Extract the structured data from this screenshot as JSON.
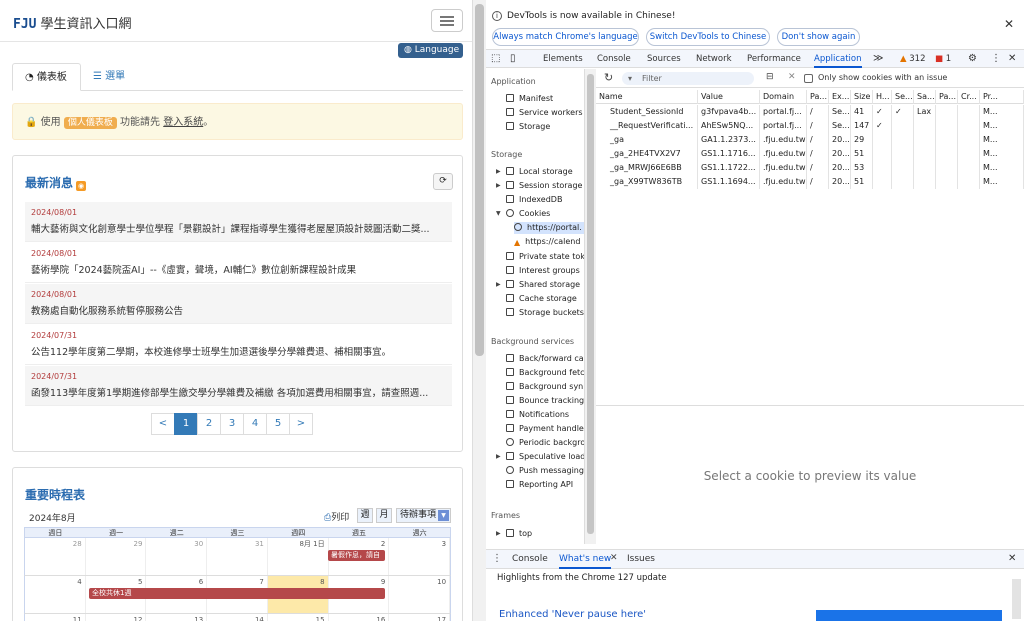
{
  "portal": {
    "brand_prefix": "FJU",
    "brand_title": "學生資訊入口網",
    "language_button": "Language",
    "tabs": [
      "儀表板",
      "選單"
    ],
    "notice": {
      "prefix": "使用",
      "badge": "個人儀表板",
      "middle": "功能請先",
      "link": "登入系統",
      "suffix": "。"
    },
    "news": {
      "title": "最新消息",
      "items": [
        {
          "date": "2024/08/01",
          "text": "輔大藝術與文化創意學士學位學程「景觀設計」課程指導學生獲得老屋屋頂設計競圖活動二獎..."
        },
        {
          "date": "2024/08/01",
          "text": "藝術學院「2024藝院盃AI」--《虛實，聲境，AI輔仁》數位創新課程設計成果"
        },
        {
          "date": "2024/08/01",
          "text": "教務處自動化服務系統暫停服務公告"
        },
        {
          "date": "2024/07/31",
          "text": "公告112學年度第二學期，本校進修學士班學生加退選後學分學雜費退、補相關事宜。"
        },
        {
          "date": "2024/07/31",
          "text": "函發113學年度第1學期進修部學生繳交學分學雜費及補繳 各項加選費用相關事宜，請查照週..."
        }
      ],
      "pager": [
        "<",
        "1",
        "2",
        "3",
        "4",
        "5",
        ">"
      ]
    },
    "schedule": {
      "title": "重要時程表",
      "month": "2024年8月",
      "print": "列印",
      "view_week": "週",
      "view_month": "月",
      "todo": "待辦事項",
      "weekdays": [
        "週日",
        "週一",
        "週二",
        "週三",
        "週四",
        "週五",
        "週六"
      ],
      "rows": [
        [
          "28",
          "29",
          "30",
          "31",
          "8月 1日",
          "2",
          "3"
        ],
        [
          "4",
          "5",
          "6",
          "7",
          "8",
          "9",
          "10"
        ],
        [
          "11",
          "12",
          "13",
          "14",
          "15",
          "16",
          "17"
        ]
      ],
      "events": [
        "暑假作息，請自",
        "全校共休1週"
      ]
    }
  },
  "devtools": {
    "banner": "DevTools is now available in Chinese!",
    "banner_buttons": [
      "Always match Chrome's language",
      "Switch DevTools to Chinese",
      "Don't show again"
    ],
    "tabs": [
      "Elements",
      "Console",
      "Sources",
      "Network",
      "Performance",
      "Application"
    ],
    "warnings": "312",
    "errors": "1",
    "sidebar": {
      "application_header": "Application",
      "application_items": [
        "Manifest",
        "Service workers",
        "Storage"
      ],
      "storage_header": "Storage",
      "storage_items": [
        "Local storage",
        "Session storage",
        "IndexedDB",
        "Cookies",
        "https://portal.",
        "https://calend",
        "Private state tok",
        "Interest groups",
        "Shared storage",
        "Cache storage",
        "Storage buckets"
      ],
      "background_header": "Background services",
      "background_items": [
        "Back/forward ca",
        "Background fetc",
        "Background syn",
        "Bounce tracking",
        "Notifications",
        "Payment handle",
        "Periodic backgro",
        "Speculative load",
        "Push messaging",
        "Reporting API"
      ],
      "frames_header": "Frames",
      "frames_items": [
        "top"
      ]
    },
    "filter_placeholder": "Filter",
    "only_issue_label": "Only show cookies with an issue",
    "columns": [
      "Name",
      "Value",
      "Domain",
      "Pa...",
      "Ex...",
      "Size",
      "H...",
      "Se...",
      "Sa...",
      "Pa...",
      "Cr...",
      "Pr..."
    ],
    "cookies": [
      [
        "Student_SessionId",
        "g3fvpava4b...",
        "portal.fj...",
        "/",
        "Se...",
        "41",
        "✓",
        "✓",
        "Lax",
        "",
        "",
        "M..."
      ],
      [
        "__RequestVerificati...",
        "AhESw5NQ...",
        "portal.fj...",
        "/",
        "Se...",
        "147",
        "✓",
        "",
        "",
        "",
        "",
        "M..."
      ],
      [
        "_ga",
        "GA1.1.2373...",
        ".fju.edu.tw",
        "/",
        "20...",
        "29",
        "",
        "",
        "",
        "",
        "",
        "M..."
      ],
      [
        "_ga_2HE4TVX2V7",
        "GS1.1.1716...",
        ".fju.edu.tw",
        "/",
        "20...",
        "51",
        "",
        "",
        "",
        "",
        "",
        "M..."
      ],
      [
        "_ga_MRWJ66E6BB",
        "GS1.1.1722...",
        ".fju.edu.tw",
        "/",
        "20...",
        "53",
        "",
        "",
        "",
        "",
        "",
        "M..."
      ],
      [
        "_ga_X99TW836TB",
        "GS1.1.1694...",
        ".fju.edu.tw",
        "/",
        "20...",
        "51",
        "",
        "",
        "",
        "",
        "",
        "M..."
      ]
    ],
    "preview_text": "Select a cookie to preview its value",
    "drawer_tabs": [
      "Console",
      "What's new",
      "Issues"
    ],
    "drawer_heading": "Highlights from the Chrome 127 update",
    "drawer_item": "Enhanced 'Never pause here'"
  }
}
